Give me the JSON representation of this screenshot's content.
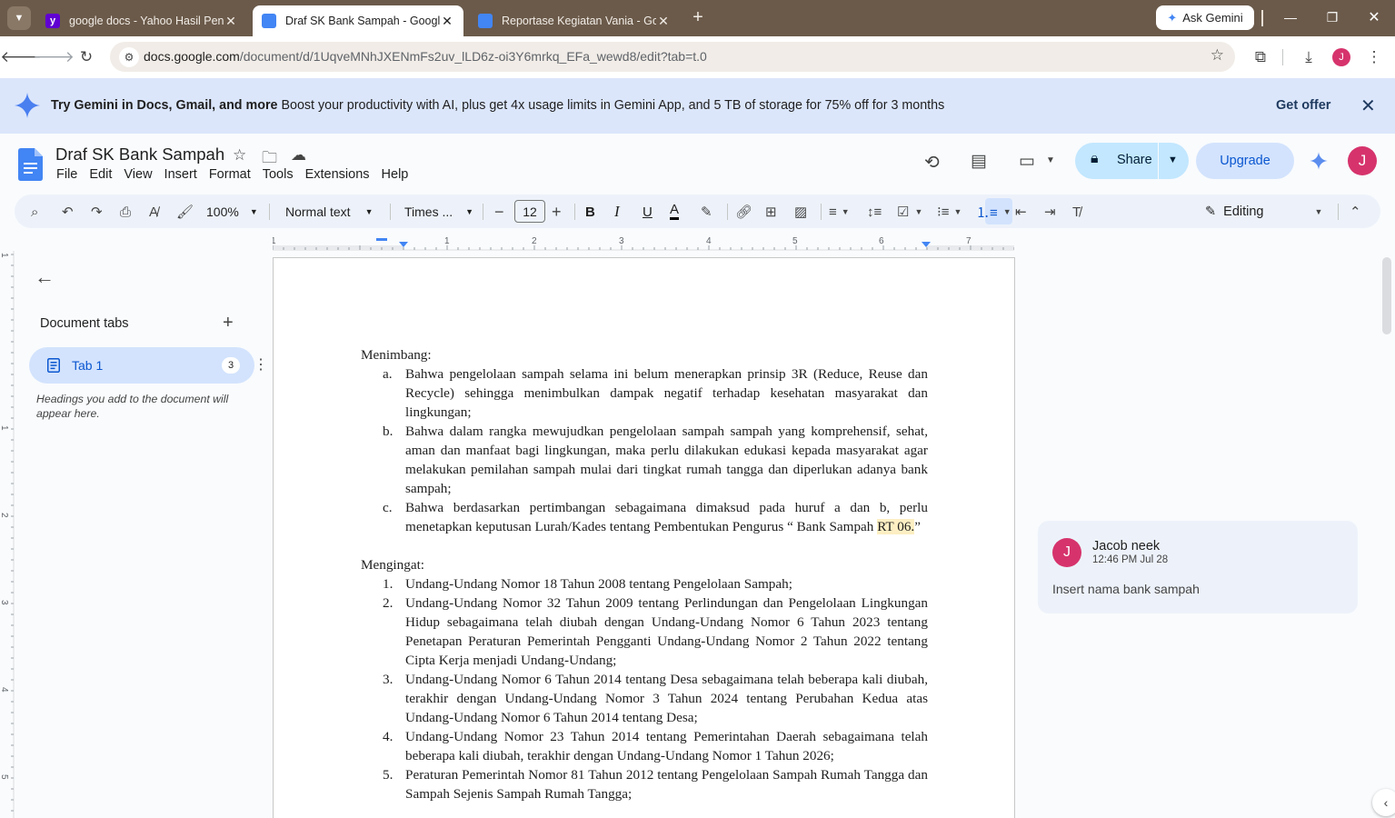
{
  "browser": {
    "tabs": [
      {
        "title": "google docs - Yahoo Hasil Penc",
        "favicon": "yahoo-icon"
      },
      {
        "title": "Draf SK Bank Sampah - Google",
        "favicon": "docs-icon",
        "active": true
      },
      {
        "title": "Reportase Kegiatan Vania - Goo",
        "favicon": "docs-icon"
      }
    ],
    "ask_gemini": "Ask Gemini",
    "url_domain": "docs.google.com",
    "url_path": "/document/d/1UqveMNhJXENmFs2uv_lLD6z-oi3Y6mrkq_EFa_wewd8/edit?tab=t.0",
    "profile_initial": "J"
  },
  "banner": {
    "bold": "Try Gemini in Docs, Gmail, and more",
    "text": "Boost your productivity with AI, plus get 4x usage limits in Gemini App, and 5 TB of storage for 75% off for 3 months",
    "offer": "Get offer"
  },
  "doc": {
    "title": "Draf SK Bank Sampah",
    "menu": [
      "File",
      "Edit",
      "View",
      "Insert",
      "Format",
      "Tools",
      "Extensions",
      "Help"
    ],
    "share": "Share",
    "upgrade": "Upgrade",
    "user_initial": "J"
  },
  "toolbar": {
    "zoom": "100%",
    "style": "Normal text",
    "font": "Times ...",
    "font_size": "12",
    "mode": "Editing"
  },
  "ruler": {
    "top_labels": [
      "1",
      "1",
      "2",
      "3",
      "4",
      "5",
      "6",
      "7"
    ],
    "left_labels": [
      "1",
      "1",
      "2",
      "3",
      "4",
      "5"
    ]
  },
  "outline": {
    "title": "Document tabs",
    "tab_name": "Tab 1",
    "tab_count": "3",
    "hint": "Headings you add to the document will appear here."
  },
  "content": {
    "menimbang": "Menimbang:",
    "menimbang_items": [
      {
        "marker": "a.",
        "text": "Bahwa pengelolaan sampah selama ini belum menerapkan prinsip 3R (Reduce,  Reuse dan Recycle) sehingga menimbulkan dampak negatif terhadap kesehatan masyarakat dan lingkungan;"
      },
      {
        "marker": "b.",
        "text": "Bahwa dalam rangka mewujudkan pengelolaan sampah sampah yang komprehensif, sehat, aman dan manfaat bagi lingkungan, maka perlu dilakukan edukasi kepada masyarakat agar melakukan pemilahan sampah mulai dari tingkat rumah tangga dan diperlukan adanya bank sampah;"
      },
      {
        "marker": "c.",
        "text_before": "Bahwa berdasarkan pertimbangan sebagaimana dimaksud pada huruf a dan b, perlu menetapkan keputusan Lurah/Kades tentang Pembentukan Pengurus “ Bank Sampah ",
        "highlight": "RT 06.",
        "text_after": "”"
      }
    ],
    "mengingat": "Mengingat:",
    "mengingat_items": [
      {
        "marker": "1.",
        "text": "Undang-Undang Nomor 18 Tahun 2008 tentang Pengelolaan Sampah;"
      },
      {
        "marker": "2.",
        "text": "Undang-Undang Nomor 32 Tahun 2009 tentang Perlindungan dan Pengelolaan Lingkungan Hidup sebagaimana telah diubah dengan Undang-Undang Nomor 6 Tahun 2023 tentang Penetapan Peraturan Pemerintah Pengganti Undang-Undang Nomor 2 Tahun 2022 tentang Cipta Kerja menjadi Undang-Undang;"
      },
      {
        "marker": "3.",
        "text": "Undang-Undang Nomor 6 Tahun 2014 tentang Desa sebagaimana telah beberapa kali diubah, terakhir dengan Undang-Undang Nomor 3 Tahun 2024 tentang Perubahan Kedua atas Undang-Undang Nomor 6 Tahun 2014 tentang Desa;"
      },
      {
        "marker": "4.",
        "text": "Undang-Undang Nomor 23 Tahun 2014 tentang Pemerintahan Daerah sebagaimana telah beberapa kali diubah, terakhir dengan Undang-Undang Nomor 1 Tahun 2026;"
      },
      {
        "marker": "5.",
        "text": "Peraturan Pemerintah Nomor 81 Tahun 2012 tentang Pengelolaan Sampah Rumah Tangga dan Sampah Sejenis Sampah Rumah Tangga;"
      }
    ]
  },
  "comment": {
    "initial": "J",
    "author": "Jacob neek",
    "time": "12:46 PM Jul 28",
    "body": "Insert nama bank sampah"
  },
  "colors": {
    "titlebar": "#6b5a4a",
    "banner": "#dbe6fb",
    "share": "#c2e7ff",
    "upgrade": "#d3e3fd",
    "avatar": "#d6336c",
    "highlight": "#fdefc3"
  }
}
